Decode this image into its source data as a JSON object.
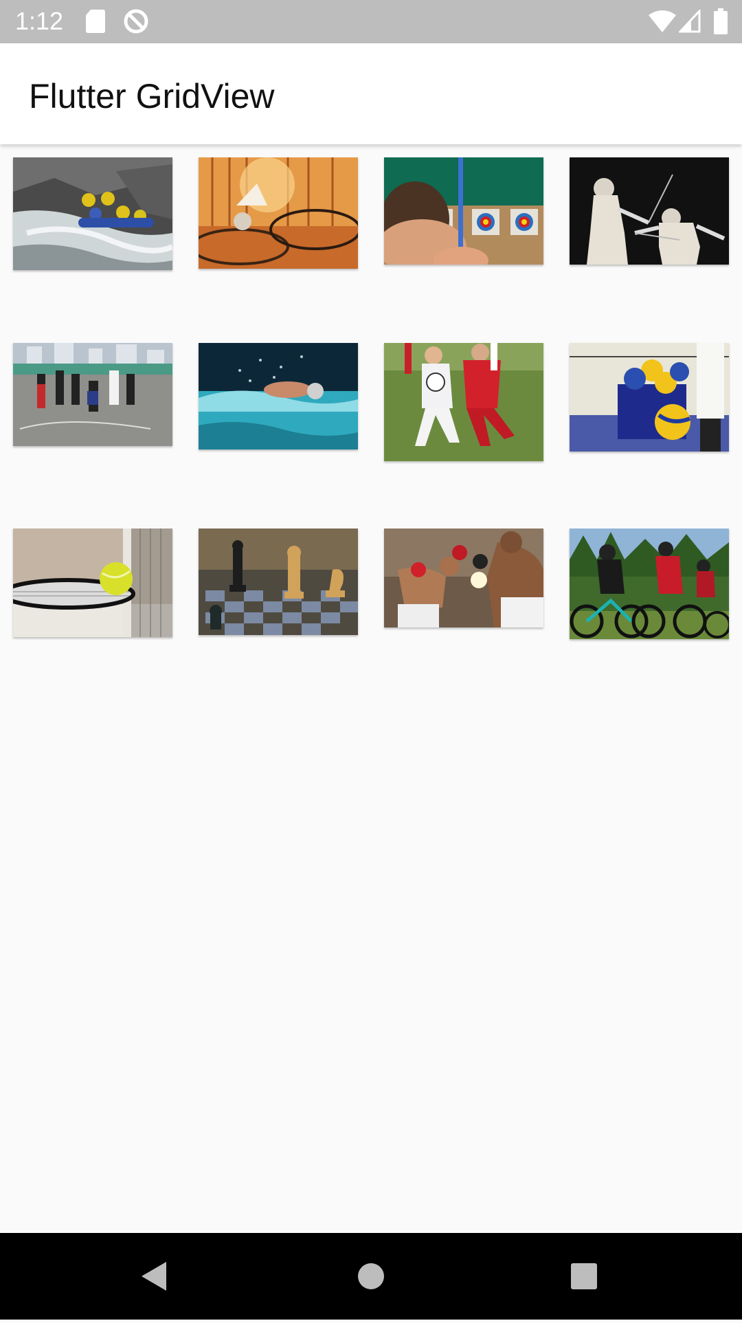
{
  "status_bar": {
    "time": "1:12",
    "left_icons": [
      "sd-card-icon",
      "data-saver-icon"
    ],
    "right_icons": [
      "wifi-icon",
      "cell-signal-icon",
      "battery-icon"
    ]
  },
  "app_bar": {
    "title": "Flutter GridView"
  },
  "grid": {
    "columns": 4,
    "images": [
      {
        "name": "rafting-image",
        "subject": "rafting"
      },
      {
        "name": "badminton-image",
        "subject": "badminton"
      },
      {
        "name": "archery-image",
        "subject": "archery"
      },
      {
        "name": "fencing-image",
        "subject": "fencing"
      },
      {
        "name": "basketball-image",
        "subject": "street basketball"
      },
      {
        "name": "swimming-image",
        "subject": "swimming"
      },
      {
        "name": "football-image",
        "subject": "football"
      },
      {
        "name": "volleyball-image",
        "subject": "volleyball"
      },
      {
        "name": "tennis-image",
        "subject": "tennis"
      },
      {
        "name": "chess-image",
        "subject": "chess"
      },
      {
        "name": "boxing-image",
        "subject": "boxing"
      },
      {
        "name": "cycling-image",
        "subject": "cycling"
      }
    ]
  },
  "nav_bar": {
    "buttons": [
      "back-icon",
      "home-icon",
      "recents-icon"
    ]
  }
}
